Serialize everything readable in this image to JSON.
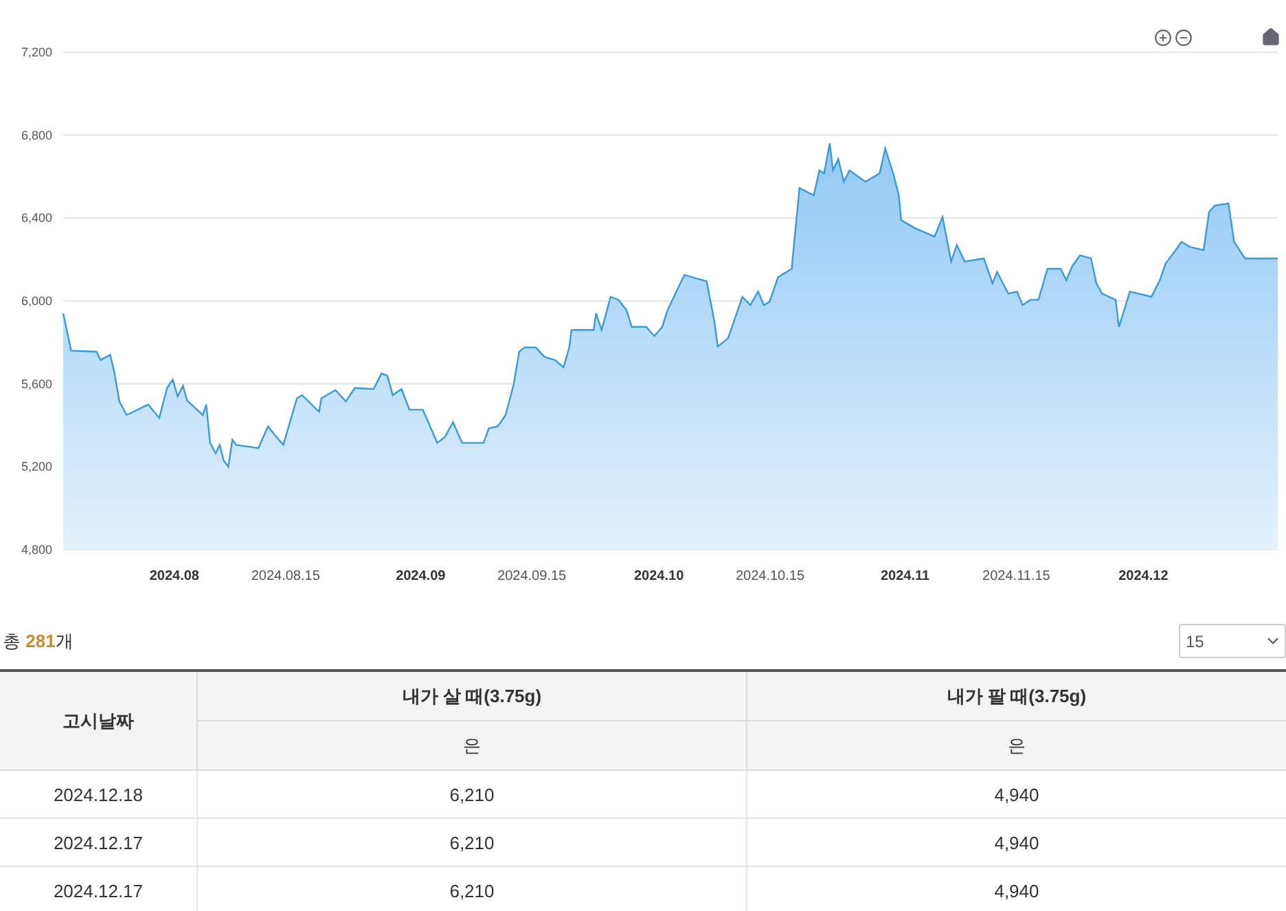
{
  "chart_data": {
    "type": "area",
    "x": [
      "2024-07-18T00:00",
      "2024-07-19T00:00",
      "2024-07-22T05:00",
      "2024-07-22T17:00",
      "2024-07-23T22:00",
      "2024-07-24T10:00",
      "2024-07-25T02:00",
      "2024-07-26T00:00",
      "2024-07-28T17:00",
      "2024-07-30T02:00",
      "2024-07-31T02:00",
      "2024-07-31T19:00",
      "2024-08-01T10:00",
      "2024-08-02T02:00",
      "2024-08-02T14:00",
      "2024-08-04T14:00",
      "2024-08-05T00:00",
      "2024-08-05T12:00",
      "2024-08-06T05:00",
      "2024-08-06T17:00",
      "2024-08-07T05:00",
      "2024-08-07T19:00",
      "2024-08-08T07:00",
      "2024-08-08T19:00",
      "2024-08-11T14:00",
      "2024-08-12T19:00",
      "2024-08-13T14:00",
      "2024-08-14T17:00",
      "2024-08-16T10:00",
      "2024-08-17T02:00",
      "2024-08-19T05:00",
      "2024-08-19T12:00",
      "2024-08-21T07:00",
      "2024-08-22T14:00",
      "2024-08-23T17:00",
      "2024-08-26T02:00",
      "2024-08-27T02:00",
      "2024-08-27T19:00",
      "2024-08-28T12:00",
      "2024-08-29T14:00",
      "2024-08-30T14:00",
      "2024-09-01T07:00",
      "2024-09-03T02:00",
      "2024-09-04T02:00",
      "2024-09-05T02:00",
      "2024-09-06T05:00",
      "2024-09-08T22:00",
      "2024-09-09T14:00",
      "2024-09-10T17:00",
      "2024-09-11T17:00",
      "2024-09-12T17:00",
      "2024-09-13T10:00",
      "2024-09-14T02:00",
      "2024-09-15T12:00",
      "2024-09-16T14:00",
      "2024-09-17T22:00",
      "2024-09-19T00:00",
      "2024-09-19T17:00",
      "2024-09-20T00:00",
      "2024-09-22T19:00",
      "2024-09-23T02:00",
      "2024-09-23T19:00",
      "2024-09-24T22:00",
      "2024-09-25T22:00",
      "2024-09-26T22:00",
      "2024-09-27T14:00",
      "2024-09-29T10:00",
      "2024-09-30T10:00",
      "2024-10-01T10:00",
      "2024-10-02T02:00",
      "2024-10-03T05:00",
      "2024-10-04T05:00",
      "2024-10-07T00:00",
      "2024-10-08T00:00",
      "2024-10-08T10:00",
      "2024-10-09T17:00",
      "2024-10-10T19:00",
      "2024-10-11T12:00",
      "2024-10-12T12:00",
      "2024-10-13T12:00",
      "2024-10-14T05:00",
      "2024-10-14T22:00",
      "2024-10-16T00:00",
      "2024-10-17T17:00",
      "2024-10-18T17:00",
      "2024-10-20T12:00",
      "2024-10-21T05:00",
      "2024-10-21T19:00",
      "2024-10-22T12:00",
      "2024-10-22T22:00",
      "2024-10-23T14:00",
      "2024-10-24T07:00",
      "2024-10-25T00:00",
      "2024-10-27T00:00",
      "2024-10-28T19:00",
      "2024-10-29T12:00",
      "2024-10-30T12:00",
      "2024-10-31T05:00",
      "2024-10-31T12:00",
      "2024-11-02T07:00",
      "2024-11-04T17:00",
      "2024-11-05T17:00",
      "2024-11-06T19:00",
      "2024-11-07T12:00",
      "2024-11-08T12:00",
      "2024-11-10T22:00",
      "2024-11-12T00:00",
      "2024-11-12T14:00",
      "2024-11-14T00:00",
      "2024-11-15T02:00",
      "2024-11-15T19:00",
      "2024-11-16T19:00",
      "2024-11-17T19:00",
      "2024-11-18T22:00",
      "2024-11-20T14:00",
      "2024-11-21T07:00",
      "2024-11-22T00:00",
      "2024-11-23T00:00",
      "2024-11-24T10:00",
      "2024-11-25T02:00",
      "2024-11-25T19:00",
      "2024-11-27T12:00",
      "2024-11-27T22:00",
      "2024-11-28T14:00",
      "2024-11-29T07:00",
      "2024-12-02T00:00",
      "2024-12-03T02:00",
      "2024-12-03T19:00",
      "2024-12-05T02:00",
      "2024-12-05T19:00",
      "2024-12-06T22:00",
      "2024-12-08T14:00",
      "2024-12-09T07:00",
      "2024-12-10T00:00",
      "2024-12-11T17:00",
      "2024-12-12T10:00",
      "2024-12-13T19:00",
      "2024-12-17T22:00"
    ],
    "series": [
      {
        "color": "#3a9ad9",
        "values": [
          5940,
          5760,
          5755,
          5715,
          5740,
          5660,
          5515,
          5450,
          5500,
          5435,
          5580,
          5620,
          5540,
          5590,
          5520,
          5450,
          5500,
          5315,
          5265,
          5305,
          5230,
          5200,
          5330,
          5305,
          5290,
          5395,
          5355,
          5305,
          5530,
          5545,
          5465,
          5530,
          5570,
          5515,
          5580,
          5575,
          5650,
          5640,
          5545,
          5575,
          5475,
          5475,
          5315,
          5345,
          5415,
          5315,
          5315,
          5385,
          5395,
          5450,
          5595,
          5755,
          5775,
          5775,
          5730,
          5715,
          5680,
          5775,
          5860,
          5860,
          5940,
          5860,
          6020,
          6005,
          5955,
          5875,
          5875,
          5830,
          5875,
          5955,
          6045,
          6125,
          6095,
          5900,
          5780,
          5820,
          5940,
          6020,
          5980,
          6045,
          5980,
          5995,
          6115,
          6155,
          6545,
          6510,
          6630,
          6615,
          6760,
          6630,
          6685,
          6575,
          6630,
          6575,
          6615,
          6735,
          6615,
          6510,
          6390,
          6350,
          6310,
          6405,
          6190,
          6270,
          6190,
          6205,
          6085,
          6140,
          6035,
          6045,
          5980,
          6005,
          6005,
          6155,
          6155,
          6100,
          6165,
          6220,
          6205,
          6085,
          6035,
          6005,
          5875,
          5955,
          6045,
          6020,
          6100,
          6180,
          6245,
          6285,
          6260,
          6245,
          6430,
          6460,
          6470,
          6285,
          6205,
          6205
        ]
      }
    ],
    "grid": true,
    "xlim": [
      "2024-07-18T00:00",
      "2024-12-17T22:00"
    ],
    "ylim": [
      4800,
      7200
    ],
    "xticks": [
      {
        "value": "2024-08-01",
        "label": "2024.08"
      },
      {
        "value": "2024-08-15",
        "label": "2024.08.15"
      },
      {
        "value": "2024-09-01",
        "label": "2024.09"
      },
      {
        "value": "2024-09-15",
        "label": "2024.09.15"
      },
      {
        "value": "2024-10-01",
        "label": "2024.10"
      },
      {
        "value": "2024-10-15",
        "label": "2024.10.15"
      },
      {
        "value": "2024-11-01",
        "label": "2024.11"
      },
      {
        "value": "2024-11-15",
        "label": "2024.11.15"
      },
      {
        "value": "2024-12-01",
        "label": "2024.12"
      }
    ],
    "yticks": [
      {
        "value": 4800,
        "label": "4,800"
      },
      {
        "value": 5200,
        "label": "5,200"
      },
      {
        "value": 5600,
        "label": "5,600"
      },
      {
        "value": 6000,
        "label": "6,000"
      },
      {
        "value": 6400,
        "label": "6,400"
      },
      {
        "value": 6800,
        "label": "6,800"
      },
      {
        "value": 7200,
        "label": "7,200"
      }
    ]
  },
  "summary": {
    "prefix": "총",
    "count": "281",
    "suffix": "개"
  },
  "page_size": {
    "value": "15"
  },
  "table": {
    "date_header": "고시날짜",
    "groups": [
      {
        "label": "내가 살 때(3.75g)",
        "sub": "은"
      },
      {
        "label": "내가 팔 때(3.75g)",
        "sub": "은"
      }
    ],
    "rows": [
      [
        "2024.12.18",
        "6,210",
        "4,940"
      ],
      [
        "2024.12.17",
        "6,210",
        "4,940"
      ],
      [
        "2024.12.17",
        "6,210",
        "4,940"
      ]
    ]
  }
}
